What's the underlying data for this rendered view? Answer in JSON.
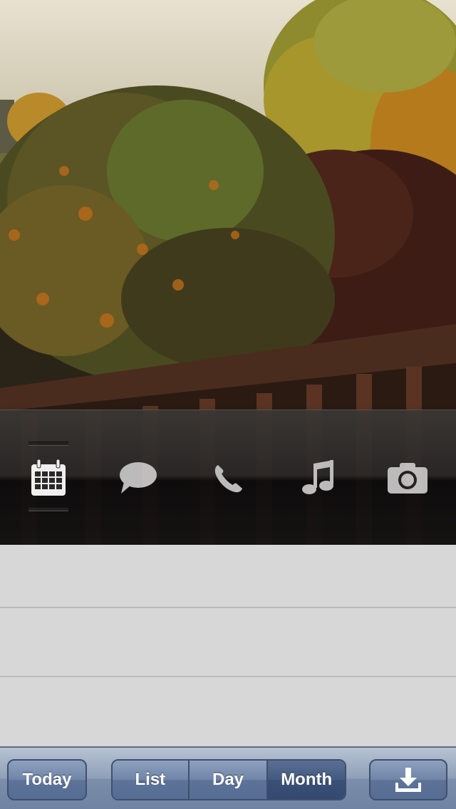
{
  "switcher": {
    "apps": [
      {
        "icon": "calendar-icon",
        "selected": true
      },
      {
        "icon": "speech-bubble-icon",
        "selected": false
      },
      {
        "icon": "phone-icon",
        "selected": false
      },
      {
        "icon": "music-note-icon",
        "selected": false
      },
      {
        "icon": "camera-icon",
        "selected": false
      }
    ]
  },
  "toolbar": {
    "today_label": "Today",
    "segments": [
      {
        "label": "List",
        "active": false
      },
      {
        "label": "Day",
        "active": false
      },
      {
        "label": "Month",
        "active": true
      }
    ],
    "action_icon": "download-icon"
  },
  "colors": {
    "toolbar_tint": "#7b8eab",
    "list_background": "#d7d7d7",
    "switcher_icon": "#c8c8c8",
    "switcher_icon_selected": "#ffffff"
  }
}
